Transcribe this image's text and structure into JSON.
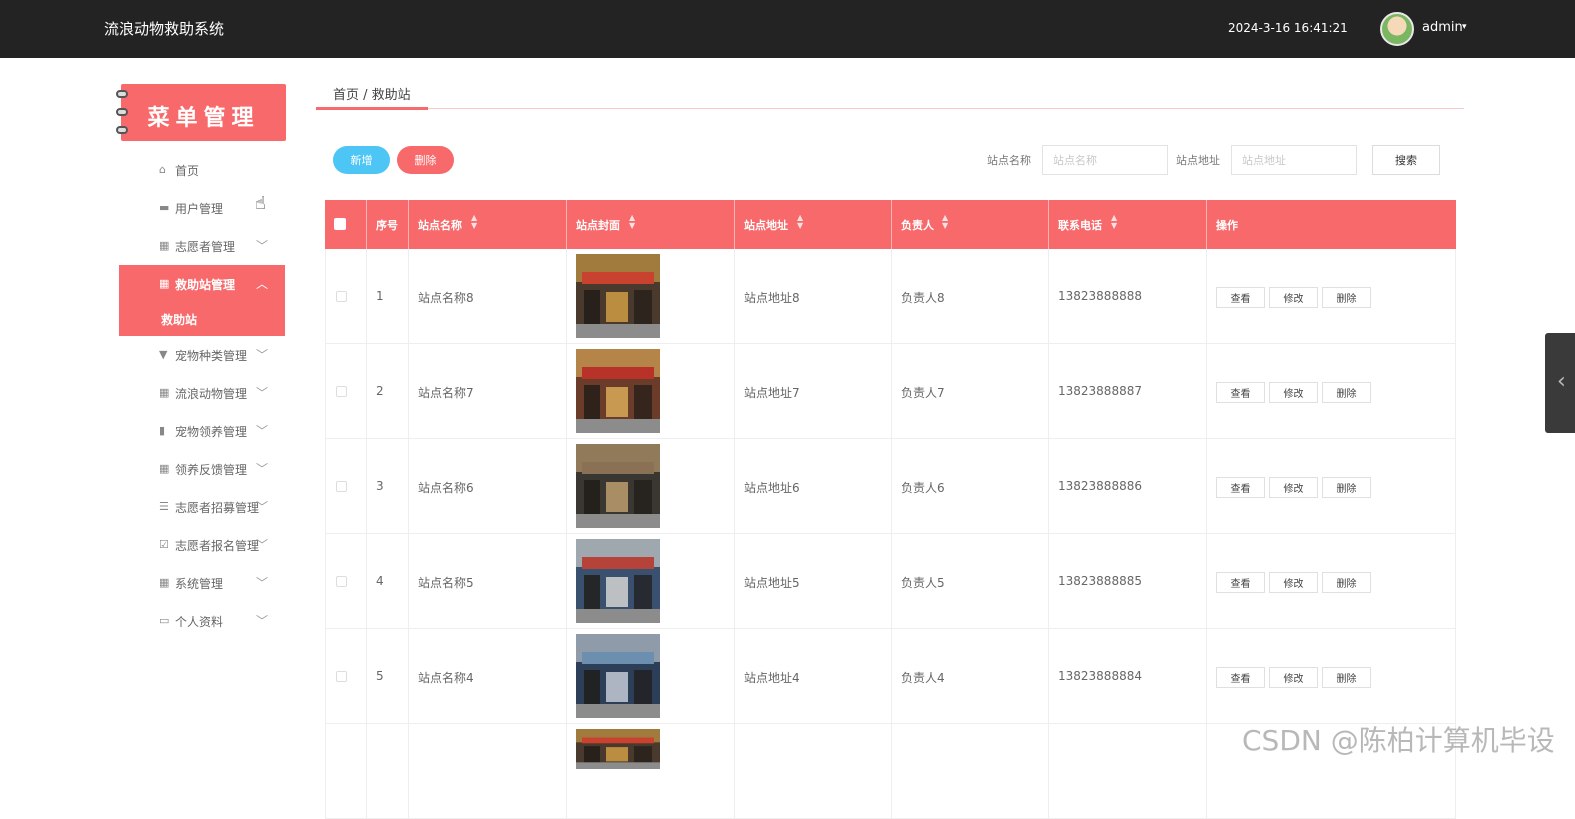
{
  "header": {
    "app_title": "流浪动物救助系统",
    "datetime": "2024-3-16 16:41:21",
    "username": "admin",
    "caret": "▾"
  },
  "sidebar": {
    "banner": "菜单管理",
    "items": [
      {
        "icon": "⌂",
        "label": "首页",
        "chevron": ""
      },
      {
        "icon": "▬",
        "label": "用户管理",
        "chevron": ""
      },
      {
        "icon": "▦",
        "label": "志愿者管理",
        "chevron": "﹀"
      },
      {
        "icon": "▦",
        "label": "救助站管理",
        "chevron": "︿"
      },
      {
        "icon": "▼",
        "label": "宠物种类管理",
        "chevron": "﹀"
      },
      {
        "icon": "▦",
        "label": "流浪动物管理",
        "chevron": "﹀"
      },
      {
        "icon": "▮",
        "label": "宠物领养管理",
        "chevron": "﹀"
      },
      {
        "icon": "▦",
        "label": "领养反馈管理",
        "chevron": "﹀"
      },
      {
        "icon": "☰",
        "label": "志愿者招募管理",
        "chevron": "﹀"
      },
      {
        "icon": "☑",
        "label": "志愿者报名管理",
        "chevron": "﹀"
      },
      {
        "icon": "▦",
        "label": "系统管理",
        "chevron": "﹀"
      },
      {
        "icon": "▭",
        "label": "个人资料",
        "chevron": "﹀"
      }
    ],
    "sub_item": "救助站"
  },
  "breadcrumb": "首页 / 救助站",
  "toolbar": {
    "add_label": "新增",
    "delete_label": "删除",
    "name_label": "站点名称",
    "name_placeholder": "站点名称",
    "address_label": "站点地址",
    "address_placeholder": "站点地址",
    "search_label": "搜索"
  },
  "table": {
    "columns": [
      "序号",
      "站点名称",
      "站点封面",
      "站点地址",
      "负责人",
      "联系电话",
      "操作"
    ],
    "rows": [
      {
        "no": "1",
        "name": "站点名称8",
        "address": "站点地址8",
        "manager": "负责人8",
        "phone": "13823888888"
      },
      {
        "no": "2",
        "name": "站点名称7",
        "address": "站点地址7",
        "manager": "负责人7",
        "phone": "13823888887"
      },
      {
        "no": "3",
        "name": "站点名称6",
        "address": "站点地址6",
        "manager": "负责人6",
        "phone": "13823888886"
      },
      {
        "no": "4",
        "name": "站点名称5",
        "address": "站点地址5",
        "manager": "负责人5",
        "phone": "13823888885"
      },
      {
        "no": "5",
        "name": "站点名称4",
        "address": "站点地址4",
        "manager": "负责人4",
        "phone": "13823888884"
      }
    ],
    "actions": {
      "view": "查看",
      "edit": "修改",
      "delete": "删除"
    }
  },
  "colors": {
    "accent": "#f7696a",
    "header_bg": "#232323",
    "add_button": "#4ec6f5"
  },
  "watermark": "CSDN @陈柏计算机毕设"
}
